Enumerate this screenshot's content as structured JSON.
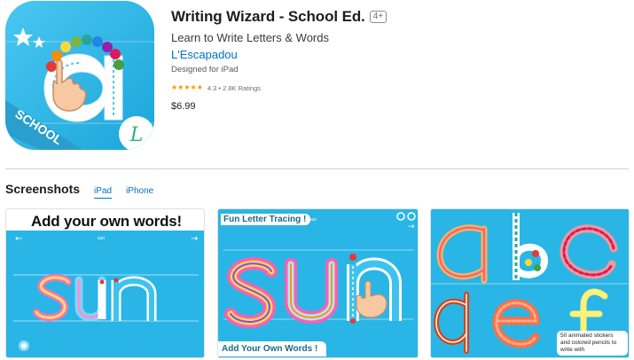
{
  "app": {
    "title": "Writing Wizard - School Ed.",
    "age_rating": "4+",
    "subtitle": "Learn to Write Letters & Words",
    "developer": "L'Escapadou",
    "platform": "Designed for iPad",
    "rating_value": 4.3,
    "rating_text": "4.3 • 2.8K Ratings",
    "price": "$6.99",
    "icon": {
      "banner_text": "SCHOOL",
      "badge_letter": "L",
      "letter": "a"
    }
  },
  "screenshots": {
    "title": "Screenshots",
    "tabs": [
      {
        "label": "iPad",
        "active": true
      },
      {
        "label": "iPhone",
        "active": false
      }
    ],
    "items": [
      {
        "headline": "Add your own words!",
        "word_label": "sun",
        "traced_word": "sun"
      },
      {
        "headline": "Fun Letter Tracing !",
        "word_label": "sun",
        "traced_word": "sun",
        "footer": "Add Your Own Words !"
      },
      {
        "letters": [
          "a",
          "b",
          "c",
          "d",
          "e",
          "f"
        ],
        "caption": "50 animated stickers and colored pencils to write with"
      }
    ]
  },
  "colors": {
    "link": "#0070c9",
    "star": "#ff9500",
    "screenshot_bg": "#29b6e6"
  }
}
